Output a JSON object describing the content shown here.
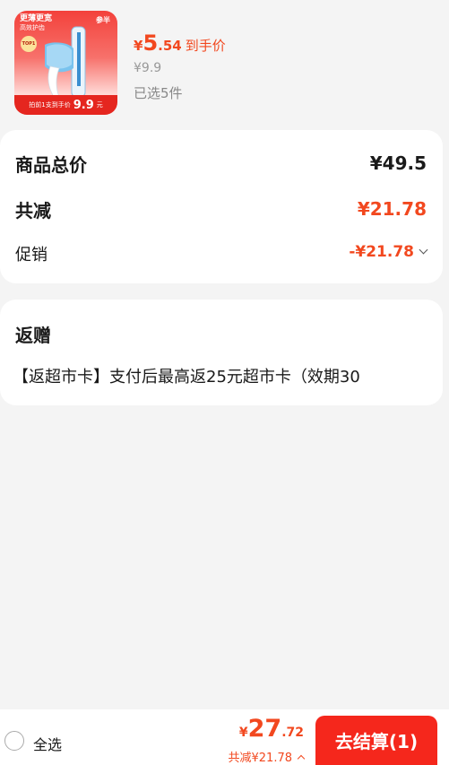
{
  "product": {
    "image_caption": "更薄更宽",
    "image_subcaption": "高效护齿",
    "image_brand": "参半",
    "image_top_badge": "TOP1",
    "image_strip_prefix": "拍前1支到手价",
    "image_strip_price": "9.9",
    "image_strip_suffix": "元",
    "price_symbol": "¥",
    "price_integer": "5",
    "price_decimal": ".54",
    "price_tag": "到手价",
    "original_price": "¥9.9",
    "selected_count": "已选5件"
  },
  "summary": {
    "goods_total_label": "商品总价",
    "goods_total_value": "¥49.5",
    "reduction_label": "共减",
    "reduction_value": "¥21.78",
    "promo_label": "促销",
    "promo_value": "-¥21.78"
  },
  "gift": {
    "title": "返赠",
    "text": "【返超市卡】支付后最高返25元超市卡（效期30"
  },
  "bottom_bar": {
    "select_all_label": "全选",
    "total_symbol": "¥",
    "total_integer": "27",
    "total_decimal": ".72",
    "total_discount": "共减¥21.78",
    "checkout_label": "去结算(1)"
  },
  "colors": {
    "accent": "#f2481f",
    "checkout_button": "#f5271c",
    "background": "#f4f4f4"
  }
}
